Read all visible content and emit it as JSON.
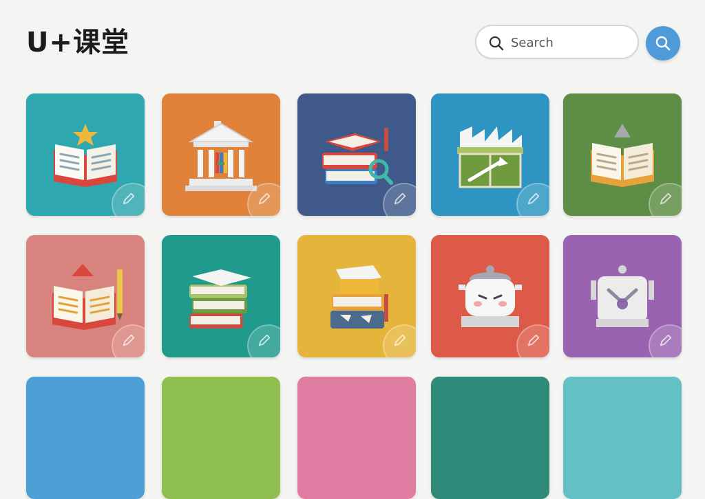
{
  "app": {
    "title": "U+课堂"
  },
  "search": {
    "placeholder": "Search"
  },
  "colors": {
    "background": "#f4f4f2",
    "search_button": "#4f9bd9"
  },
  "tiles": [
    {
      "id": "book-star",
      "color": "#2fa7ae",
      "icon": "open-book-star-icon"
    },
    {
      "id": "library",
      "color": "#e0823a",
      "icon": "library-building-icon"
    },
    {
      "id": "book-stack-search",
      "color": "#3f5a8a",
      "icon": "book-stack-magnifier-icon"
    },
    {
      "id": "castle-box",
      "color": "#2e95c2",
      "icon": "castle-box-icon"
    },
    {
      "id": "book-mountain",
      "color": "#5e8d45",
      "icon": "open-book-mountain-icon"
    },
    {
      "id": "book-pencil",
      "color": "#d9837e",
      "icon": "open-book-pencil-icon"
    },
    {
      "id": "book-stack-cap",
      "color": "#1f9a8c",
      "icon": "book-stack-graduation-cap-icon"
    },
    {
      "id": "book-stack-box",
      "color": "#e5b43a",
      "icon": "book-stack-box-icon"
    },
    {
      "id": "cooking-pot",
      "color": "#dc5a47",
      "icon": "cooking-pot-face-icon"
    },
    {
      "id": "machine",
      "color": "#9a63b2",
      "icon": "machine-wrench-icon"
    },
    {
      "id": "row3-1",
      "color": "#4d9fd6",
      "icon": "tile-icon"
    },
    {
      "id": "row3-2",
      "color": "#8fbf4e",
      "icon": "tile-icon"
    },
    {
      "id": "row3-3",
      "color": "#e07ba2",
      "icon": "tile-icon"
    },
    {
      "id": "row3-4",
      "color": "#2f8a79",
      "icon": "tile-icon"
    },
    {
      "id": "row3-5",
      "color": "#63c0c4",
      "icon": "tile-icon"
    }
  ]
}
